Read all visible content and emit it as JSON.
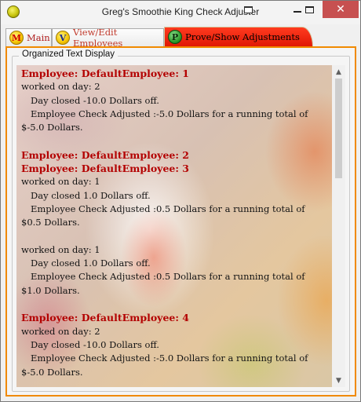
{
  "window": {
    "title": "Greg's Smoothie King Check Adjuster",
    "app_icon": "smoothie-app-icon",
    "close_glyph": "✕"
  },
  "tabs": [
    {
      "label": "Main",
      "badge": "M",
      "active": false
    },
    {
      "label": "View/Edit Employees",
      "badge": "V",
      "active": false
    },
    {
      "label": "Prove/Show Adjustments",
      "badge": "P",
      "active": true
    }
  ],
  "panel": {
    "group_label": "Organized Text Display",
    "lines": [
      {
        "type": "head",
        "text": "Employee: DefaultEmployee: 1"
      },
      {
        "type": "plain",
        "text": "worked on day: 2"
      },
      {
        "type": "indent",
        "text": "Day closed -10.0 Dollars off."
      },
      {
        "type": "indent",
        "text": "Employee Check Adjusted :-5.0 Dollars for a running total of"
      },
      {
        "type": "plain",
        "text": "$-5.0 Dollars."
      },
      {
        "type": "blank",
        "text": ""
      },
      {
        "type": "head",
        "text": "Employee: DefaultEmployee: 2"
      },
      {
        "type": "head",
        "text": "Employee: DefaultEmployee: 3"
      },
      {
        "type": "plain",
        "text": "worked on day: 1"
      },
      {
        "type": "indent",
        "text": "Day closed 1.0 Dollars off."
      },
      {
        "type": "indent",
        "text": "Employee Check Adjusted :0.5 Dollars for a running total of"
      },
      {
        "type": "plain",
        "text": "$0.5 Dollars."
      },
      {
        "type": "blank",
        "text": ""
      },
      {
        "type": "plain",
        "text": "worked on day: 1"
      },
      {
        "type": "indent",
        "text": "Day closed 1.0 Dollars off."
      },
      {
        "type": "indent",
        "text": "Employee Check Adjusted :0.5 Dollars for a running total of"
      },
      {
        "type": "plain",
        "text": "$1.0 Dollars."
      },
      {
        "type": "blank",
        "text": ""
      },
      {
        "type": "head",
        "text": "Employee: DefaultEmployee: 4"
      },
      {
        "type": "plain",
        "text": "worked on day: 2"
      },
      {
        "type": "indent",
        "text": "Day closed -10.0 Dollars off."
      },
      {
        "type": "indent",
        "text": "Employee Check Adjusted :-5.0 Dollars for a running total of"
      },
      {
        "type": "plain",
        "text": "$-5.0 Dollars."
      }
    ]
  },
  "scrollbar": {
    "up_glyph": "▲",
    "down_glyph": "▼",
    "position_fraction": 0
  },
  "colors": {
    "accent_border": "#f08a00",
    "active_tab": "#e01805",
    "employee_heading": "#b30000",
    "close_button": "#c75050"
  }
}
